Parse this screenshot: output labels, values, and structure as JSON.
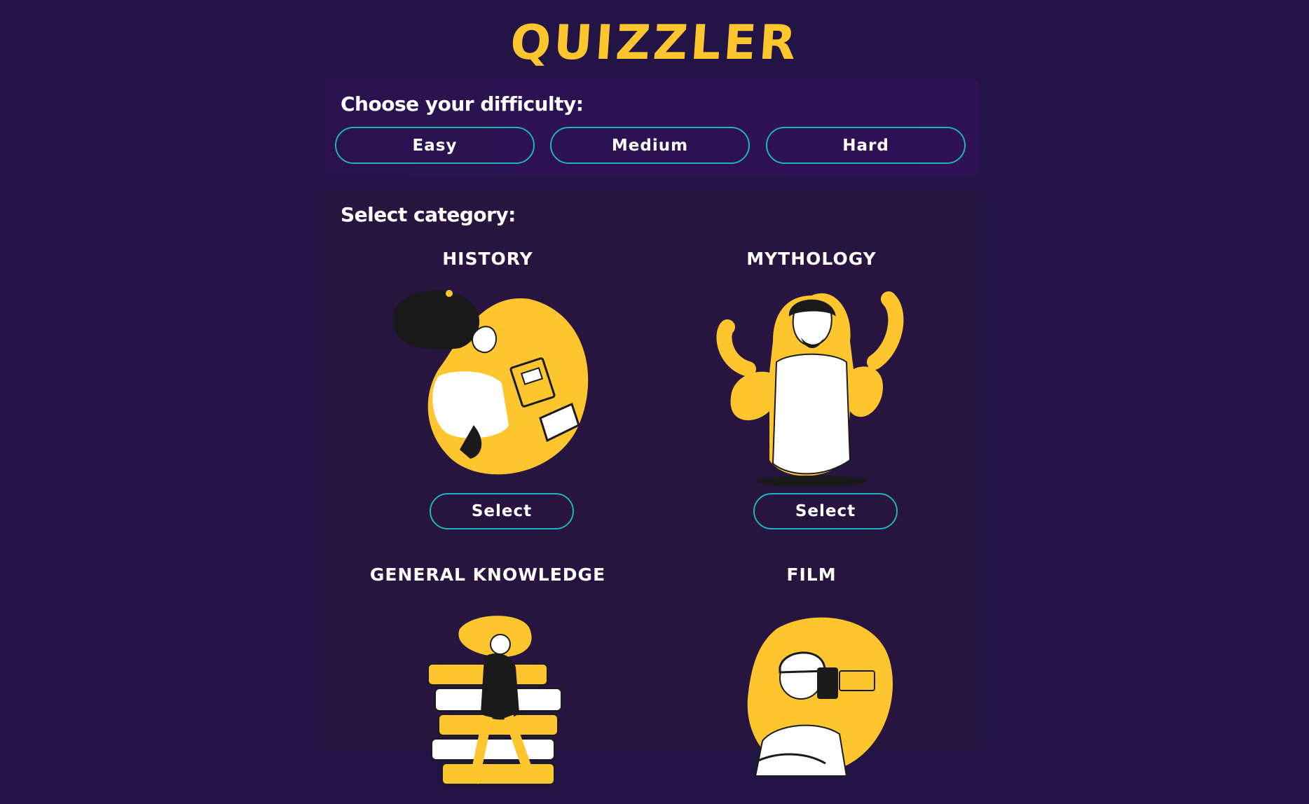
{
  "app": {
    "logo": "QUIZZLER"
  },
  "difficulty": {
    "title": "Choose your difficulty:",
    "options": [
      "Easy",
      "Medium",
      "Hard"
    ]
  },
  "category": {
    "title": "Select category:",
    "items": [
      {
        "name": "History",
        "button": "Select",
        "illustration": "woman-reading-book-illustration"
      },
      {
        "name": "Mythology",
        "button": "Select",
        "illustration": "multi-armed-figure-illustration"
      },
      {
        "name": "General Knowledge",
        "button": "",
        "illustration": "person-with-books-illustration"
      },
      {
        "name": "Film",
        "button": "",
        "illustration": "person-with-camera-illustration"
      }
    ]
  },
  "colors": {
    "background": "#231446",
    "accent": "#fdc62f",
    "border": "#1fb5b8",
    "panel": "#28153f"
  }
}
